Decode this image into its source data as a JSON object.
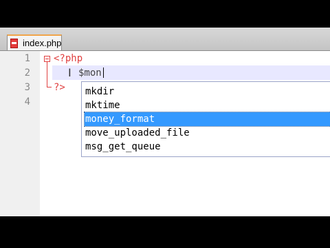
{
  "tab": {
    "label": "index.php",
    "icon": "php-file-icon"
  },
  "editor": {
    "line_numbers": [
      "1",
      "2",
      "3",
      "4"
    ],
    "line1_code": "<?php",
    "line2_code": "$mon",
    "line3_code": "?>"
  },
  "autocomplete": {
    "items": [
      "mkdir",
      "mktime",
      "money_format",
      "move_uploaded_file",
      "msg_get_queue"
    ],
    "selected": "money_format"
  },
  "colors": {
    "selection": "#3399ff",
    "php_tag": "#e04040",
    "current_line": "#e8e8ff"
  }
}
